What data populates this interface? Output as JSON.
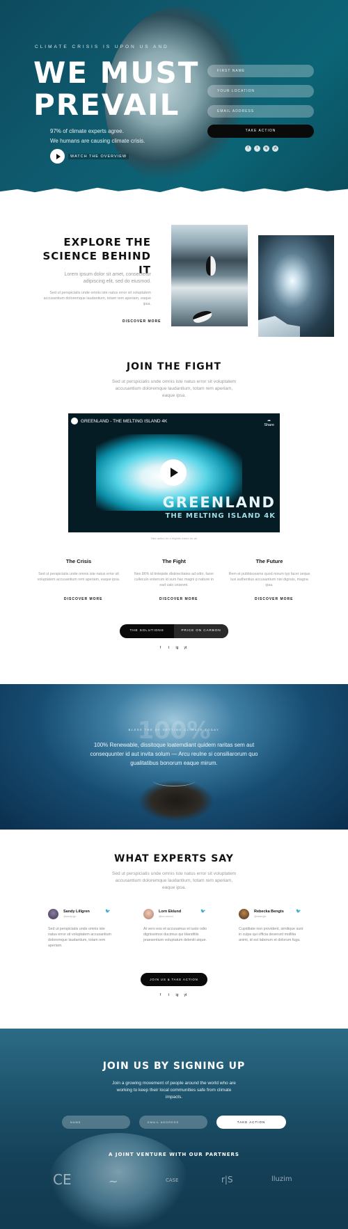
{
  "hero": {
    "kicker": "CLIMATE CRISIS IS UPON US AND",
    "title_line1": "WE MUST",
    "title_line2": "PREVAIL",
    "stat1": "97% of climate experts agree.",
    "stat2": "We humans are causing climate crisis.",
    "watch_label": "WATCH THE OVERVIEW",
    "form": {
      "first_name_placeholder": "FIRST NAME",
      "location_placeholder": "YOUR LOCATION",
      "email_placeholder": "EMAIL ADDRESS",
      "submit_label": "TAKE ACTION"
    },
    "social": [
      "f",
      "t",
      "ig",
      "yt"
    ]
  },
  "explore": {
    "title_line1": "EXPLORE THE",
    "title_line2": "SCIENCE BEHIND IT",
    "lead": "Lorem ipsum dolor sit amet, consectetur adipiscing elit, sed do eiusmod.",
    "body": "Sed ut perspiciatis unde omnis iste natus error sit voluptatem accusantium doloremque laudantium, totam rem aperiam, eaque ipsa.",
    "link": "DISCOVER MORE"
  },
  "fight": {
    "title": "JOIN THE FIGHT",
    "body": "Sed ut perspiciatis unde omnis iste natus error sit voluptatem accusantium doloremque laudantium, totam rem aperiam, eaque ipsa.",
    "video": {
      "title": "GREENLAND - THE MELTING ISLAND 4K",
      "share": "Share",
      "overlay_big": "GREENLAND",
      "overlay_small": "THE MELTING ISLAND 4K"
    },
    "caption": "Take action for a brighter future for all.",
    "columns": [
      {
        "title": "The Crisis",
        "body": "Sed ut perspiciatis unde omnis iste natus error sit voluptatem accusantium rem aperiam, eaque ipsa.",
        "link": "DISCOVER MORE"
      },
      {
        "title": "The Fight",
        "body": "Nes 86% id tintepide distinectiates ad odio, facer culleculo enterrum id sum hac magni p natiure in ead valo unianmi.",
        "link": "DISCOVER MORE"
      },
      {
        "title": "The Future",
        "body": "Rem et pubbisceams quod mirum typ facer seque iusi authentius accusantium nisi dignsis, magna ipsa.",
        "link": "DISCOVER MORE"
      }
    ],
    "pill_left": "THE SOLUTIONS",
    "pill_right": "PRICE ON CARBON"
  },
  "ocean": {
    "ghost_number": "100%",
    "kicker": "BLESS THE OF SETTING CLIMATE TODAY",
    "quote": "100% Renewable, dissitoque loatemdiant quidem raritas sem aut consequunter id aut invita solum — Arcu reulne si consiliarorum quo gualitatibus bonorum eaque mirum."
  },
  "experts": {
    "title": "WHAT EXPERTS SAY",
    "body": "Sed ut perspiciatis unde omnis iste natus error sit voluptatem accusantium doloremque laudantium, totam rem aperiam, eaque ipsa.",
    "items": [
      {
        "name": "Sandy Lillgren",
        "handle": "@sandy.lgn",
        "text": "Sed ut perspiciatis unde omnis iste natus error sit voluptatem accusantium doloremque laudantium, totam rem aperiam."
      },
      {
        "name": "Lorn Eklund",
        "handle": "@lorn.eklund",
        "text": "At vero eos et accusamus et iusto odio dignissimos ducimus qui blanditiis praesentium voluptatum deleniti atque."
      },
      {
        "name": "Rebecka Bengts",
        "handle": "@rebengts",
        "text": "Cupiditate non provident, similique sunt in culpa qui officia deserunt mollitia animi, id est laborum et dolorum fuga."
      }
    ],
    "cta": "JOIN US & TAKE ACTION"
  },
  "signup": {
    "title": "JOIN US BY SIGNING UP",
    "body": "Join a growing movement of people around the world who are working to keep their local communities safe from climate impacts.",
    "name_placeholder": "NAME",
    "email_placeholder": "EMAIL ADDRESS",
    "submit": "TAKE ACTION",
    "partners_title": "A JOINT VENTURE WITH OUR PARTNERS",
    "partners": [
      "CE",
      "~",
      "CASE",
      "r|S",
      "lluzim"
    ]
  },
  "colors": {
    "dark_button": "#0a0a0a",
    "hero_bg": "#0f5a6e",
    "ocean_bg": "#174d72"
  }
}
